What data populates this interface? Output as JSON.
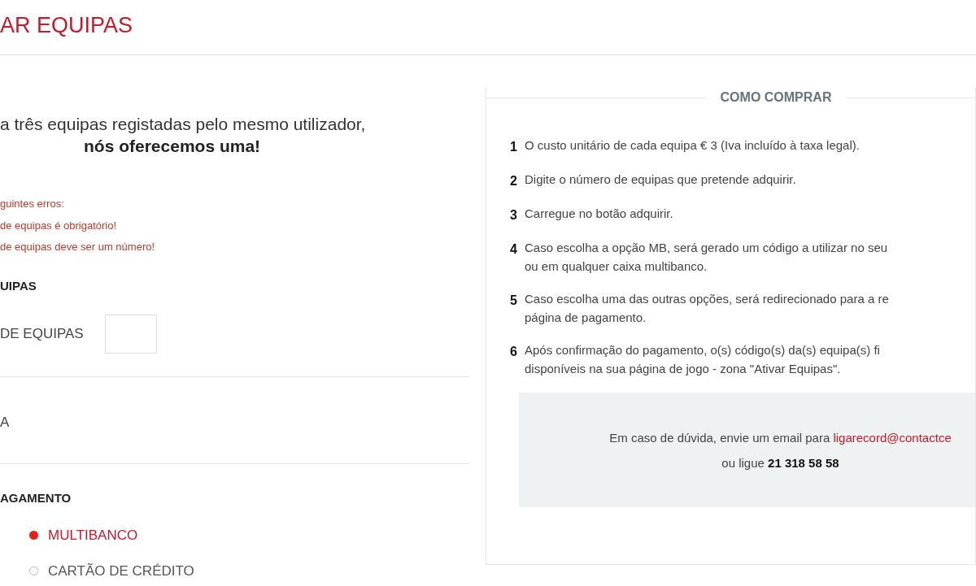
{
  "page_title": "AR EQUIPAS",
  "intro": {
    "line": "a três equipas registadas pelo mesmo utilizador,",
    "highlight": "nós oferecemos uma!"
  },
  "errors": [
    "guintes erros:",
    "de equipas é obrigatório!",
    "de equipas deve ser um número!"
  ],
  "teams_section": {
    "heading": "UIPAS",
    "quantity_label": "DE EQUIPAS"
  },
  "summary_label": "A",
  "payment": {
    "heading": "AGAMENTO",
    "options": [
      {
        "label": "MULTIBANCO",
        "selected": true
      },
      {
        "label": "CARTÃO DE CRÉDITO",
        "selected": false
      }
    ]
  },
  "how_to_buy": {
    "title": "COMO COMPRAR",
    "steps": [
      {
        "number": "1",
        "text": "O custo unitário de cada equipa € 3 (Iva incluído à taxa legal)."
      },
      {
        "number": "2",
        "text": "Digite o número de equipas que pretende adquirir."
      },
      {
        "number": "3",
        "text": "Carregue no botão adquirir."
      },
      {
        "number": "4",
        "text": "Caso escolha a opção MB, será gerado um código a utilizar no seu\nou em qualquer caixa multibanco."
      },
      {
        "number": "5",
        "text": "Caso escolha uma das outras opções, será redirecionado para a re\npágina de pagamento."
      },
      {
        "number": "6",
        "text": "Após confirmação do pagamento, o(s) código(s) da(s) equipa(s) fi\ndisponíveis na sua página de jogo - zona \"Ativar Equipas\"."
      }
    ],
    "help": {
      "text": "Em caso de dúvida, envie um email para",
      "email": "ligarecord@contactce",
      "phone_text": "ou ligue",
      "phone": "21 318 58 58"
    }
  }
}
